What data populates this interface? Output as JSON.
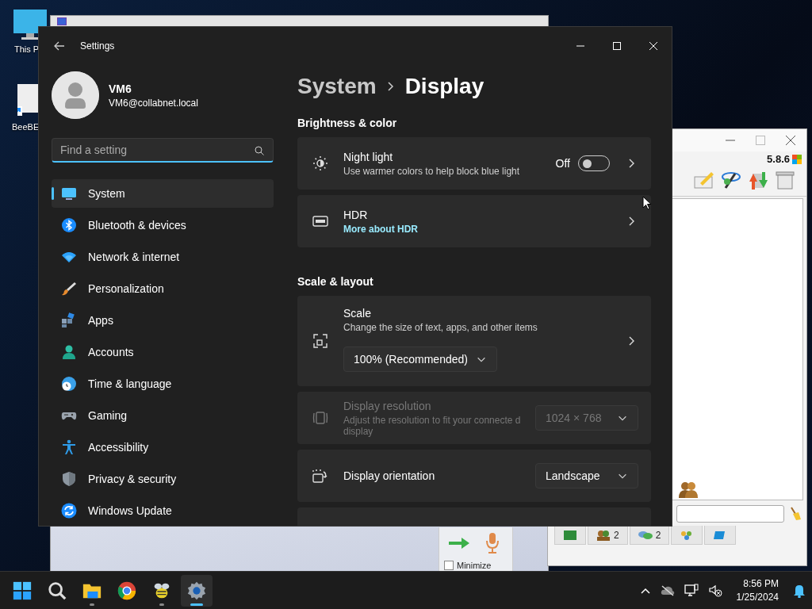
{
  "desktop": {
    "icons": [
      {
        "label": "This P"
      },
      {
        "label": "BeeBE"
      }
    ]
  },
  "chat_window": {
    "version": "5.8.6",
    "tabs": [
      {
        "kind": "screen"
      },
      {
        "kind": "users",
        "count": "2"
      },
      {
        "kind": "chats",
        "count": "2"
      },
      {
        "kind": "groups"
      },
      {
        "kind": "flag"
      }
    ]
  },
  "back_window": {
    "checkbox": {
      "label": "Minimize",
      "checked": false
    }
  },
  "settings": {
    "title": "Settings",
    "user": {
      "name": "VM6",
      "email": "VM6@collabnet.local"
    },
    "search": {
      "placeholder": "Find a setting"
    },
    "nav": [
      {
        "label": "System",
        "selected": true
      },
      {
        "label": "Bluetooth & devices",
        "selected": false
      },
      {
        "label": "Network & internet",
        "selected": false
      },
      {
        "label": "Personalization",
        "selected": false
      },
      {
        "label": "Apps",
        "selected": false
      },
      {
        "label": "Accounts",
        "selected": false
      },
      {
        "label": "Time & language",
        "selected": false
      },
      {
        "label": "Gaming",
        "selected": false
      },
      {
        "label": "Accessibility",
        "selected": false
      },
      {
        "label": "Privacy & security",
        "selected": false
      },
      {
        "label": "Windows Update",
        "selected": false
      }
    ],
    "breadcrumb": [
      "System",
      "Display"
    ],
    "sections": [
      {
        "title": "Brightness & color",
        "cards": [
          {
            "kind": "toggle",
            "title": "Night light",
            "description": "Use warmer colors to help block blue light",
            "state_label": "Off",
            "on": false
          },
          {
            "kind": "link",
            "title": "HDR",
            "link": "More about HDR"
          }
        ]
      },
      {
        "title": "Scale & layout",
        "cards": [
          {
            "kind": "dropdown_below",
            "title": "Scale",
            "description": "Change the size of text, apps, and other items",
            "value": "100% (Recommended)"
          },
          {
            "kind": "dropdown",
            "title": "Display resolution",
            "description": "Adjust the resolution to fit your connecte d display",
            "value": "1024 × 768",
            "disabled": true
          },
          {
            "kind": "dropdown",
            "title": "Display orientation",
            "value": "Landscape",
            "disabled": false
          }
        ]
      }
    ]
  },
  "taskbar": {
    "apps": [
      {
        "running": false,
        "active": false
      },
      {
        "running": false,
        "active": false
      },
      {
        "running": true,
        "active": false
      },
      {
        "running": false,
        "active": false
      },
      {
        "running": true,
        "active": false
      },
      {
        "running": true,
        "active": true
      }
    ],
    "clock": {
      "time": "8:56 PM",
      "date": "1/25/2024"
    }
  }
}
